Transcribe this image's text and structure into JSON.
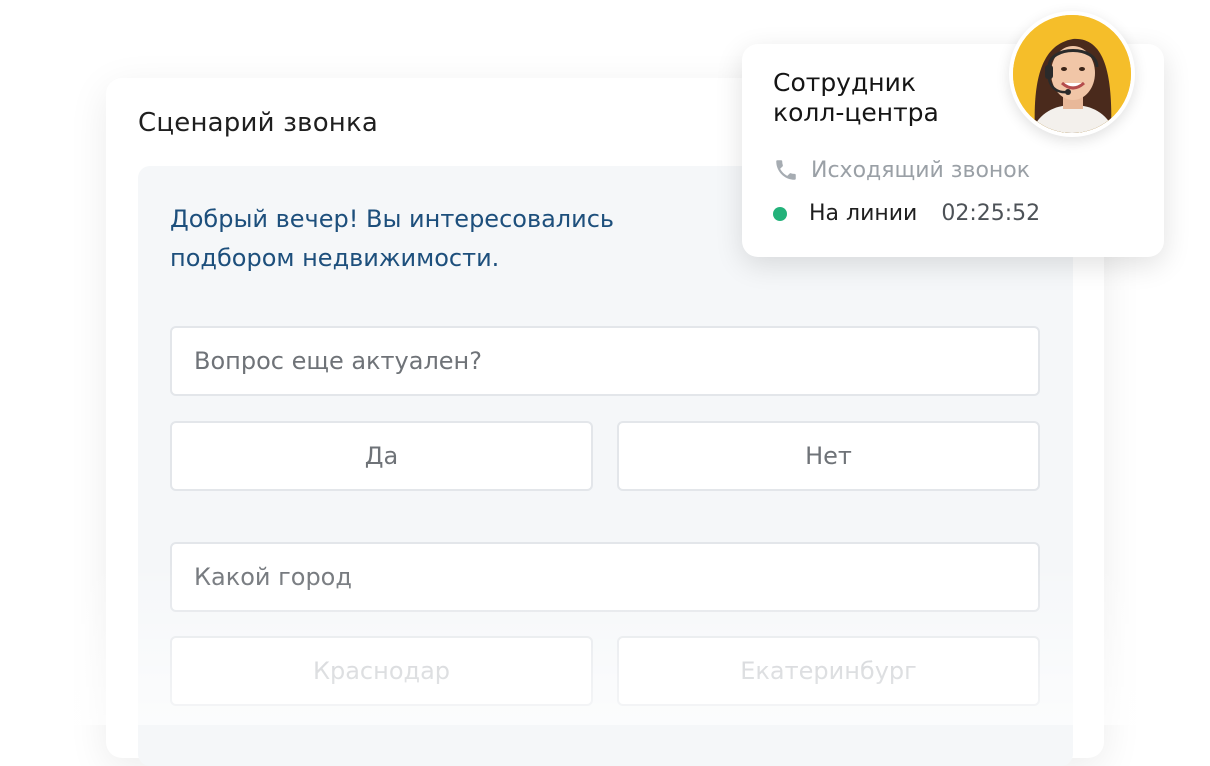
{
  "script_card": {
    "title": "Сценарий звонка",
    "greeting": "Добрый вечер! Вы интересовались подбором недвижимости.",
    "question_1": "Вопрос еще актуален?",
    "answer_yes": "Да",
    "answer_no": "Нет",
    "question_2": "Какой город",
    "city_1": "Краснодар",
    "city_2": "Екатеринбург"
  },
  "agent_card": {
    "title": "Сотрудник колл-центра",
    "call_type": "Исходящий звонок",
    "status": "На линии",
    "timer": "02:25:52",
    "avatar_bg": "#f5be2a",
    "status_color": "#23b27a",
    "call_icon": "phone-icon"
  }
}
